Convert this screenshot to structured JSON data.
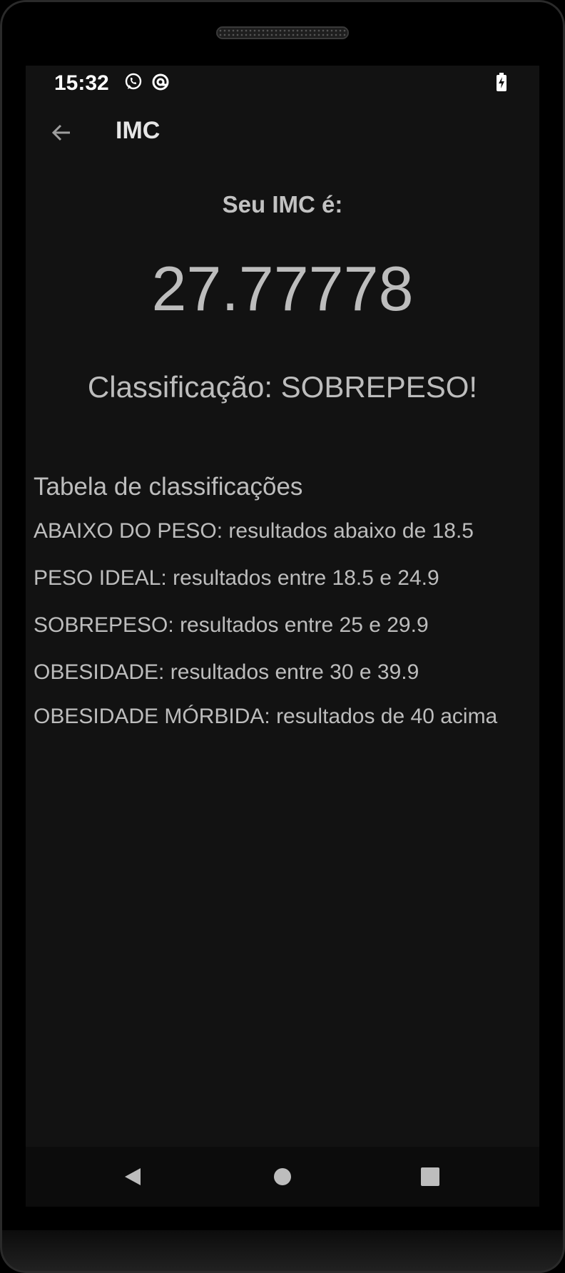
{
  "status_bar": {
    "time": "15:32",
    "icons": [
      "whatsapp-icon",
      "at-sign-icon",
      "battery-charging-icon"
    ]
  },
  "app_bar": {
    "back_icon": "arrow-left-icon",
    "title": "IMC"
  },
  "result": {
    "label": "Seu IMC é:",
    "value": "27.77778",
    "classification": "Classificação: SOBREPESO!"
  },
  "table": {
    "title": "Tabela de classificações",
    "rows": [
      "ABAIXO DO PESO: resultados abaixo de 18.5",
      "PESO IDEAL: resultados entre 18.5 e 24.9",
      "SOBREPESO: resultados entre 25 e 29.9",
      "OBESIDADE: resultados entre 30 e 39.9",
      "OBESIDADE MÓRBIDA: resultados de 40 acima"
    ]
  },
  "nav_bar": {
    "icons": [
      "nav-back-icon",
      "nav-home-icon",
      "nav-recents-icon"
    ]
  },
  "colors": {
    "background": "#121212",
    "text": "#bdbdbd",
    "title": "#e6e6e6",
    "status_text": "#ffffff"
  }
}
